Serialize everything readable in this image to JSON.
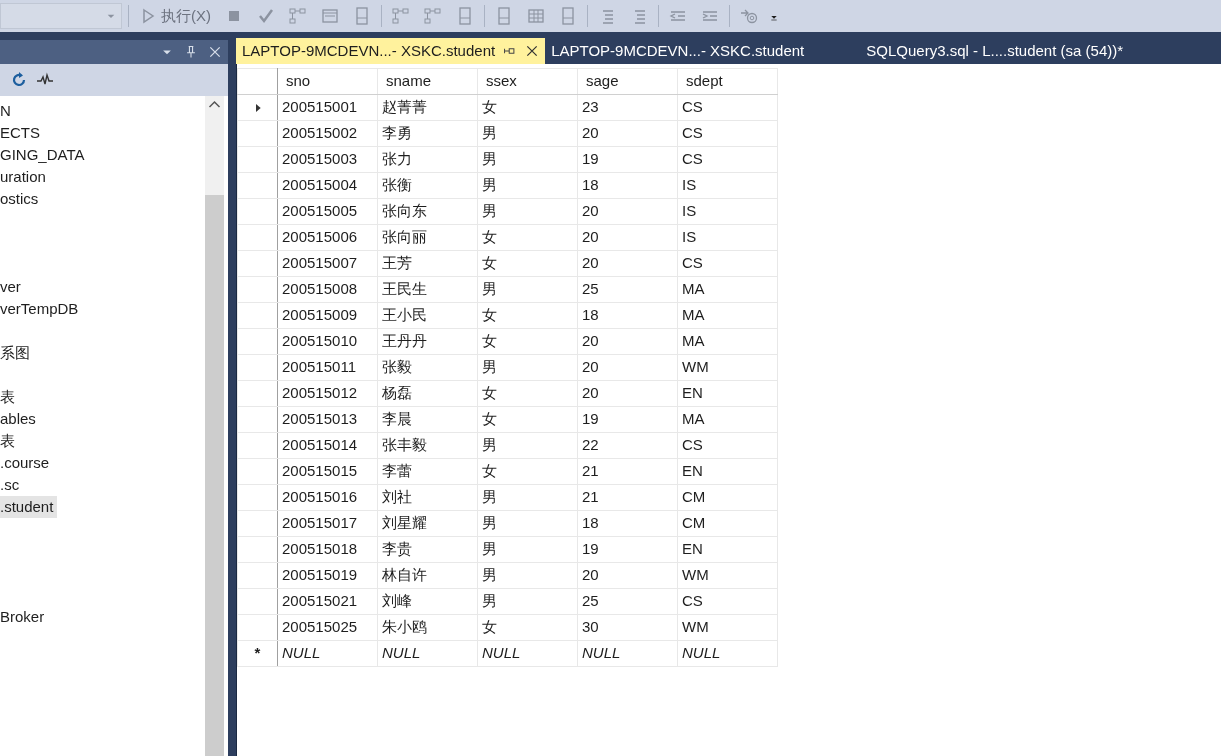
{
  "toolbar": {
    "execute_label": "执行(X)"
  },
  "object_explorer": {
    "items": [
      {
        "kind": "item",
        "label": "N",
        "selected": false
      },
      {
        "kind": "item",
        "label": "ECTS",
        "selected": false
      },
      {
        "kind": "item",
        "label": "GING_DATA",
        "selected": false
      },
      {
        "kind": "item",
        "label": "uration",
        "selected": false
      },
      {
        "kind": "item",
        "label": "ostics",
        "selected": false
      },
      {
        "kind": "spacer"
      },
      {
        "kind": "spacer"
      },
      {
        "kind": "spacer"
      },
      {
        "kind": "item",
        "label": "ver",
        "selected": false
      },
      {
        "kind": "item",
        "label": "verTempDB",
        "selected": false
      },
      {
        "kind": "spacer"
      },
      {
        "kind": "item",
        "label": "系图",
        "selected": false
      },
      {
        "kind": "spacer"
      },
      {
        "kind": "item",
        "label": "表",
        "selected": false
      },
      {
        "kind": "item",
        "label": "ables",
        "selected": false
      },
      {
        "kind": "item",
        "label": "表",
        "selected": false
      },
      {
        "kind": "item",
        "label": ".course",
        "selected": false
      },
      {
        "kind": "item",
        "label": ".sc",
        "selected": false
      },
      {
        "kind": "item",
        "label": ".student",
        "selected": true
      },
      {
        "kind": "spacer"
      },
      {
        "kind": "spacer"
      },
      {
        "kind": "spacer"
      },
      {
        "kind": "spacer"
      },
      {
        "kind": "item",
        "label": "Broker",
        "selected": false
      }
    ]
  },
  "tabs": [
    {
      "label": "LAPTOP-9MCDEVN...- XSKC.student",
      "selected": true
    },
    {
      "label": "LAPTOP-9MCDEVN...- XSKC.student",
      "selected": false
    },
    {
      "label": "SQLQuery3.sql - L....student (sa (54))*",
      "selected": false
    }
  ],
  "grid": {
    "columns": [
      "sno",
      "sname",
      "ssex",
      "sage",
      "sdept"
    ],
    "rows": [
      {
        "kind": "data",
        "selected": true,
        "cells": [
          "200515001",
          "赵菁菁",
          "女",
          "23",
          "CS"
        ]
      },
      {
        "kind": "data",
        "selected": false,
        "cells": [
          "200515002",
          "李勇",
          "男",
          "20",
          "CS"
        ]
      },
      {
        "kind": "data",
        "selected": false,
        "cells": [
          "200515003",
          "张力",
          "男",
          "19",
          "CS"
        ]
      },
      {
        "kind": "data",
        "selected": false,
        "cells": [
          "200515004",
          "张衡",
          "男",
          "18",
          "IS"
        ]
      },
      {
        "kind": "data",
        "selected": false,
        "cells": [
          "200515005",
          "张向东",
          "男",
          "20",
          "IS"
        ]
      },
      {
        "kind": "data",
        "selected": false,
        "cells": [
          "200515006",
          "张向丽",
          "女",
          "20",
          "IS"
        ]
      },
      {
        "kind": "data",
        "selected": false,
        "cells": [
          "200515007",
          "王芳",
          "女",
          "20",
          "CS"
        ]
      },
      {
        "kind": "data",
        "selected": false,
        "cells": [
          "200515008",
          "王民生",
          "男",
          "25",
          "MA"
        ]
      },
      {
        "kind": "data",
        "selected": false,
        "cells": [
          "200515009",
          "王小民",
          "女",
          "18",
          "MA"
        ]
      },
      {
        "kind": "data",
        "selected": false,
        "cells": [
          "200515010",
          "王丹丹",
          "女",
          "20",
          "MA"
        ]
      },
      {
        "kind": "data",
        "selected": false,
        "cells": [
          "200515011",
          "张毅",
          "男",
          "20",
          "WM"
        ]
      },
      {
        "kind": "data",
        "selected": false,
        "cells": [
          "200515012",
          "杨磊",
          "女",
          "20",
          "EN"
        ]
      },
      {
        "kind": "data",
        "selected": false,
        "cells": [
          "200515013",
          "李晨",
          "女",
          "19",
          "MA"
        ]
      },
      {
        "kind": "data",
        "selected": false,
        "cells": [
          "200515014",
          "张丰毅",
          "男",
          "22",
          "CS"
        ]
      },
      {
        "kind": "data",
        "selected": false,
        "cells": [
          "200515015",
          "李蕾",
          "女",
          "21",
          "EN"
        ]
      },
      {
        "kind": "data",
        "selected": false,
        "cells": [
          "200515016",
          "刘社",
          "男",
          "21",
          "CM"
        ]
      },
      {
        "kind": "data",
        "selected": false,
        "cells": [
          "200515017",
          "刘星耀",
          "男",
          "18",
          "CM"
        ]
      },
      {
        "kind": "data",
        "selected": false,
        "cells": [
          "200515018",
          "李贵",
          "男",
          "19",
          "EN"
        ]
      },
      {
        "kind": "data",
        "selected": false,
        "cells": [
          "200515019",
          "林自许",
          "男",
          "20",
          "WM"
        ]
      },
      {
        "kind": "data",
        "selected": false,
        "cells": [
          "200515021",
          "刘峰",
          "男",
          "25",
          "CS"
        ]
      },
      {
        "kind": "data",
        "selected": false,
        "cells": [
          "200515025",
          "朱小鸥",
          "女",
          "30",
          "WM"
        ]
      },
      {
        "kind": "new",
        "selected": false,
        "marker": "*",
        "cells": [
          "NULL",
          "NULL",
          "NULL",
          "NULL",
          "NULL"
        ]
      }
    ]
  }
}
